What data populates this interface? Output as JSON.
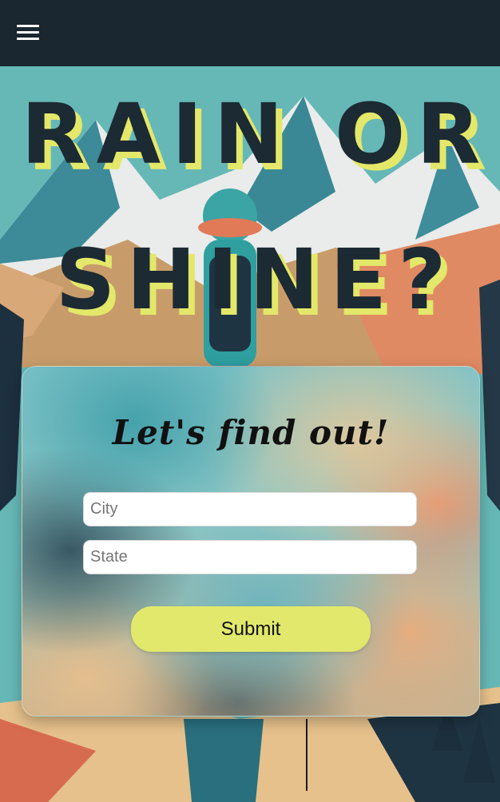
{
  "navbar": {
    "menu_icon": "hamburger-menu-icon"
  },
  "hero": {
    "title_line1": "RAIN OR",
    "title_line2": "SHINE?"
  },
  "form": {
    "heading": "Let's find out!",
    "city_placeholder": "City",
    "state_placeholder": "State",
    "submit_label": "Submit"
  },
  "colors": {
    "navbar": "#1a2630",
    "title_text": "#1c2a33",
    "title_shadow": "#e3e86a",
    "submit_button": "#e1e86b"
  }
}
